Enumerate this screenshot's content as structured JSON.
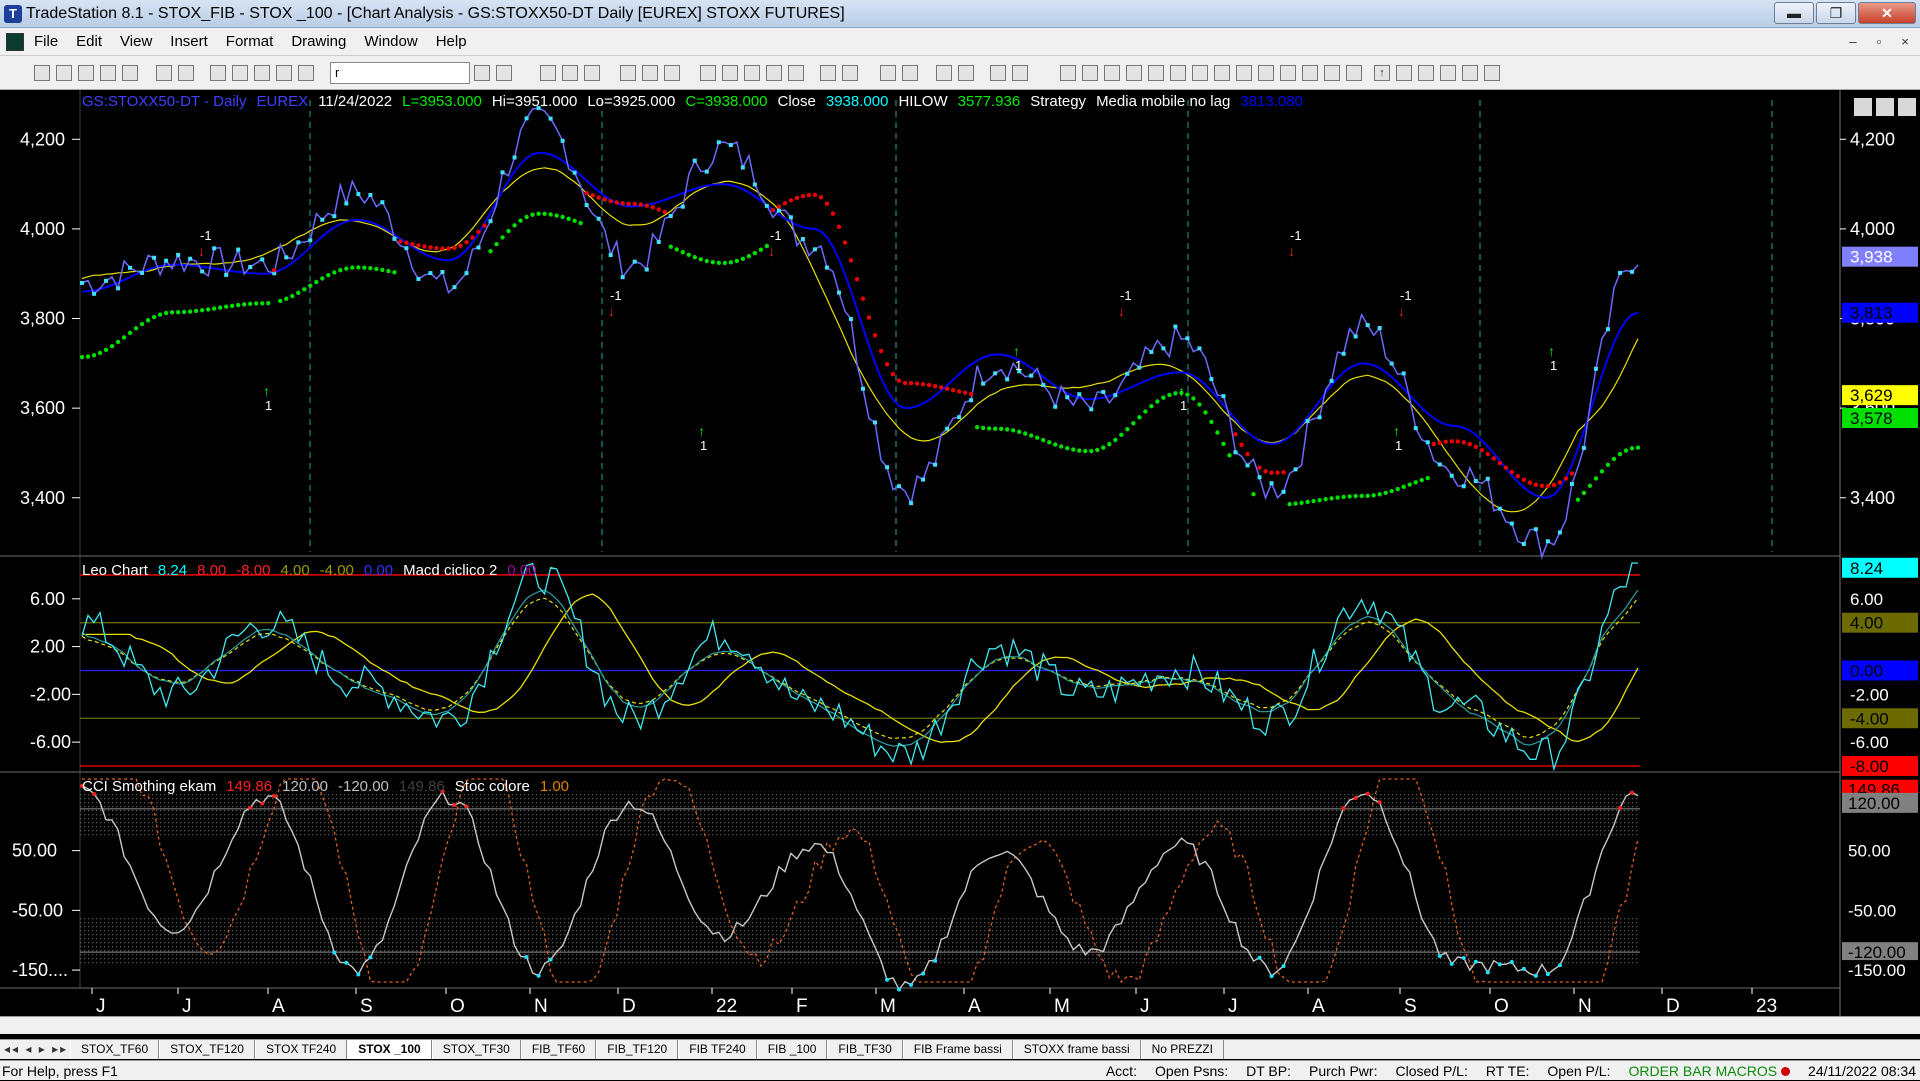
{
  "window": {
    "title": "TradeStation 8.1 - STOX_FIB - STOX _100 - [Chart Analysis - GS:STOXX50-DT  Daily  [EUREX] STOXX FUTURES]",
    "minimize": "▬",
    "restore": "❐",
    "close": "✕"
  },
  "menu": {
    "items": [
      "File",
      "Edit",
      "View",
      "Insert",
      "Format",
      "Drawing",
      "Window",
      "Help"
    ],
    "mdi": [
      "–",
      "▫",
      "×"
    ]
  },
  "toolbar": {
    "symbol_value": "r"
  },
  "chart": {
    "header": {
      "symbol": "GS:STOXX50-DT - Daily",
      "exchange": "EUREX",
      "date": "11/24/2022",
      "last": "L=3953.000",
      "hi": "Hi=3951.000",
      "lo": "Lo=3925.000",
      "close": "C=3938.000",
      "close_label": "Close",
      "close_val": "3938.000",
      "hilow_label": "HILOW",
      "hilow_val": "3577.936",
      "strategy_label": "Strategy",
      "mm_label": "Media mobile no lag",
      "mm_val": "3813.080"
    },
    "price_axis": {
      "ticks": [
        "4,200",
        "4,000",
        "3,800",
        "3,600",
        "3,400"
      ]
    },
    "price_tags": [
      {
        "text": "3,938",
        "color": "#8080ff",
        "fg": "#ffffff"
      },
      {
        "text": "3,813",
        "color": "#0000ff",
        "fg": "#000000"
      },
      {
        "text": "3,629",
        "color": "#ffff00",
        "fg": "#000000"
      },
      {
        "text": "3,578",
        "color": "#00e000",
        "fg": "#000000"
      }
    ],
    "signal_labels": [
      "-1",
      "1",
      "-1",
      "1",
      "-1",
      "1",
      "-1",
      "1",
      "-1",
      "1",
      "-1",
      "1"
    ],
    "leo_header": {
      "name": "Leo Chart",
      "v1": "8.24",
      "v2": "8.00",
      "v3": "-8.00",
      "v4": "4.00",
      "v5": "-4.00",
      "v6": "0.00",
      "name2": "Macd ciclico 2",
      "v7": "0.00"
    },
    "leo_axis": {
      "ticks": [
        "6.00",
        "2.00",
        "-2.00",
        "-6.00"
      ]
    },
    "leo_tags": [
      {
        "text": "8.24",
        "color": "#00ffff",
        "fg": "#000000"
      },
      {
        "text": "6.00",
        "color": "#000000",
        "fg": "#ffffff"
      },
      {
        "text": "4.00",
        "color": "#6b6b00",
        "fg": "#000000"
      },
      {
        "text": "0.00",
        "color": "#0000ff",
        "fg": "#000000"
      },
      {
        "text": "-2.00",
        "color": "#000000",
        "fg": "#ffffff"
      },
      {
        "text": "-4.00",
        "color": "#6b6b00",
        "fg": "#000000"
      },
      {
        "text": "-6.00",
        "color": "#000000",
        "fg": "#ffffff"
      },
      {
        "text": "-8.00",
        "color": "#ff0000",
        "fg": "#000000"
      }
    ],
    "cci_header": {
      "name": "CCI Smothing ekam",
      "v1": "149.86",
      "v2": "120.00",
      "v3": "-120.00",
      "v4": "149.86",
      "name2": "Stoc colore",
      "v5": "1.00"
    },
    "cci_axis": {
      "ticks": [
        "50.00",
        "-50.00",
        "-150...."
      ]
    },
    "cci_tags": [
      {
        "text": "149.86",
        "color": "#ff0000",
        "fg": "#000000"
      },
      {
        "text": "120.00",
        "color": "#808080",
        "fg": "#000000"
      },
      {
        "text": "50.00",
        "color": "#000000",
        "fg": "#ffffff"
      },
      {
        "text": "-50.00",
        "color": "#000000",
        "fg": "#ffffff"
      },
      {
        "text": "-120.00",
        "color": "#808080",
        "fg": "#000000"
      },
      {
        "text": "-150.00",
        "color": "#000000",
        "fg": "#ffffff"
      }
    ],
    "x_axis": [
      "J",
      "J",
      "A",
      "S",
      "O",
      "N",
      "D",
      "22",
      "F",
      "M",
      "A",
      "M",
      "J",
      "J",
      "A",
      "S",
      "O",
      "N",
      "D",
      "23"
    ]
  },
  "tabs": {
    "nav": "◂◂ ◂ ▸ ▸▸",
    "items": [
      "STOX_TF60",
      "STOX_TF120",
      "STOX TF240",
      "STOX _100",
      "STOX_TF30",
      "FIB_TF60",
      "FIB_TF120",
      "FIB TF240",
      "FIB _100",
      "FIB_TF30",
      "FIB Frame bassi",
      "STOXX frame bassi",
      "No PREZZI"
    ],
    "active": 3
  },
  "status": {
    "help": "For Help, press F1",
    "acct": "Acct:",
    "open_psns": "Open Psns:",
    "dt_bp": "DT BP:",
    "purch_pwr": "Purch Pwr:",
    "closed_pl": "Closed P/L:",
    "rt_te": "RT TE:",
    "open_pl": "Open P/L:",
    "macros": "ORDER BAR  MACROS",
    "datetime": "24/11/2022 08:34"
  },
  "chart_data": [
    {
      "type": "line",
      "title": "GS:STOXX50-DT - Daily",
      "ylim": [
        3270,
        4310
      ],
      "x": [
        "J",
        "J",
        "A",
        "S",
        "O",
        "N",
        "D",
        "22",
        "F",
        "M",
        "A",
        "M",
        "J",
        "J",
        "A",
        "S",
        "O",
        "N"
      ],
      "series": [
        {
          "name": "Close",
          "values": [
            3880,
            3930,
            3920,
            4080,
            3870,
            4240,
            3920,
            4180,
            3970,
            3420,
            3700,
            3600,
            3750,
            3420,
            3780,
            3460,
            3300,
            3940
          ]
        },
        {
          "name": "HILOW",
          "values": [
            3780,
            3880,
            3900,
            3980,
            3950,
            4100,
            4050,
            3990,
            4070,
            3650,
            3620,
            3570,
            3700,
            3450,
            3470,
            3520,
            3420,
            3578
          ]
        },
        {
          "name": "Media mobile no lag",
          "values": [
            3860,
            3920,
            3900,
            4020,
            3930,
            4170,
            4050,
            4100,
            4000,
            3600,
            3720,
            3620,
            3680,
            3520,
            3700,
            3560,
            3400,
            3813
          ]
        }
      ]
    },
    {
      "type": "line",
      "title": "Leo Chart",
      "ylim": [
        -8.5,
        9.5
      ],
      "x": [
        "J",
        "J",
        "A",
        "S",
        "O",
        "N",
        "D",
        "22",
        "F",
        "M",
        "A",
        "M",
        "J",
        "J",
        "A",
        "S",
        "O",
        "N"
      ],
      "series": [
        {
          "values": [
            4,
            -2,
            4,
            -1,
            -4,
            8,
            -4,
            3,
            -3,
            -7,
            2,
            -2,
            0,
            -4,
            6,
            -3,
            -7,
            8.24
          ]
        }
      ]
    },
    {
      "type": "line",
      "title": "CCI Smothing ekam",
      "ylim": [
        -180,
        180
      ],
      "x": [
        "J",
        "J",
        "A",
        "S",
        "O",
        "N",
        "D",
        "22",
        "F",
        "M",
        "A",
        "M",
        "J",
        "J",
        "A",
        "S",
        "O",
        "N"
      ],
      "series": [
        {
          "values": [
            150,
            -80,
            140,
            -150,
            140,
            -150,
            130,
            -90,
            60,
            -180,
            50,
            -120,
            60,
            -150,
            150,
            -140,
            -150,
            149.86
          ]
        }
      ]
    }
  ]
}
